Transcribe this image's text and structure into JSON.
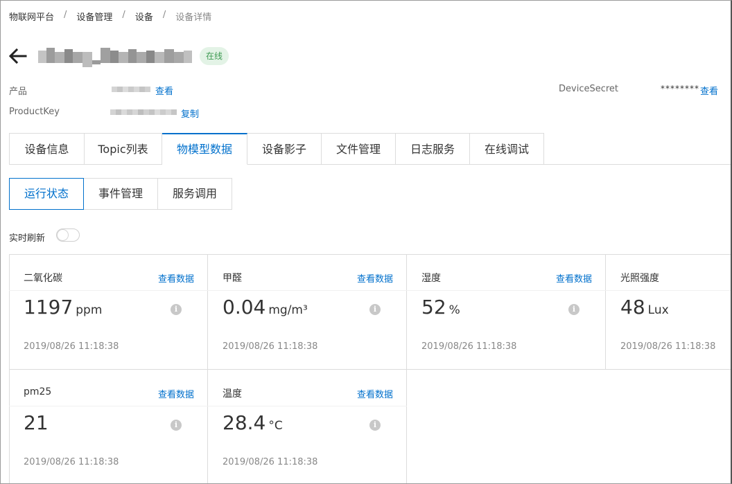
{
  "breadcrumb": [
    "物联网平台",
    "设备管理",
    "设备",
    "设备详情"
  ],
  "breadcrumb_separator": "/",
  "device": {
    "status": "在线"
  },
  "meta": {
    "product_label": "产品",
    "product_link": "查看",
    "productkey_label": "ProductKey",
    "productkey_link": "复制",
    "devicesecret_label": "DeviceSecret",
    "devicesecret_value": "********",
    "devicesecret_link": "查看"
  },
  "tabs": [
    {
      "label": "设备信息",
      "active": false
    },
    {
      "label": "Topic列表",
      "active": false
    },
    {
      "label": "物模型数据",
      "active": true
    },
    {
      "label": "设备影子",
      "active": false
    },
    {
      "label": "文件管理",
      "active": false
    },
    {
      "label": "日志服务",
      "active": false
    },
    {
      "label": "在线调试",
      "active": false
    }
  ],
  "subtabs": [
    {
      "label": "运行状态",
      "active": true
    },
    {
      "label": "事件管理",
      "active": false
    },
    {
      "label": "服务调用",
      "active": false
    }
  ],
  "realtime": {
    "label": "实时刷新",
    "enabled": false
  },
  "cards": [
    {
      "title": "二氧化碳",
      "link": "查看数据",
      "value": "1197",
      "unit": "ppm",
      "time": "2019/08/26 11:18:38"
    },
    {
      "title": "甲醛",
      "link": "查看数据",
      "value": "0.04",
      "unit": "mg/m³",
      "time": "2019/08/26 11:18:38"
    },
    {
      "title": "湿度",
      "link": "查看数据",
      "value": "52",
      "unit": "%",
      "time": "2019/08/26 11:18:38"
    },
    {
      "title": "光照强度",
      "link": "",
      "value": "48",
      "unit": "Lux",
      "time": "2019/08/26 11:18:38"
    },
    {
      "title": "pm25",
      "link": "查看数据",
      "value": "21",
      "unit": "",
      "time": "2019/08/26 11:18:38"
    },
    {
      "title": "温度",
      "link": "查看数据",
      "value": "28.4",
      "unit": "°C",
      "time": "2019/08/26 11:18:38"
    }
  ],
  "colors": {
    "accent": "#0070cc",
    "status_green": "#3d9a52",
    "status_bg": "#e3f3e6"
  }
}
